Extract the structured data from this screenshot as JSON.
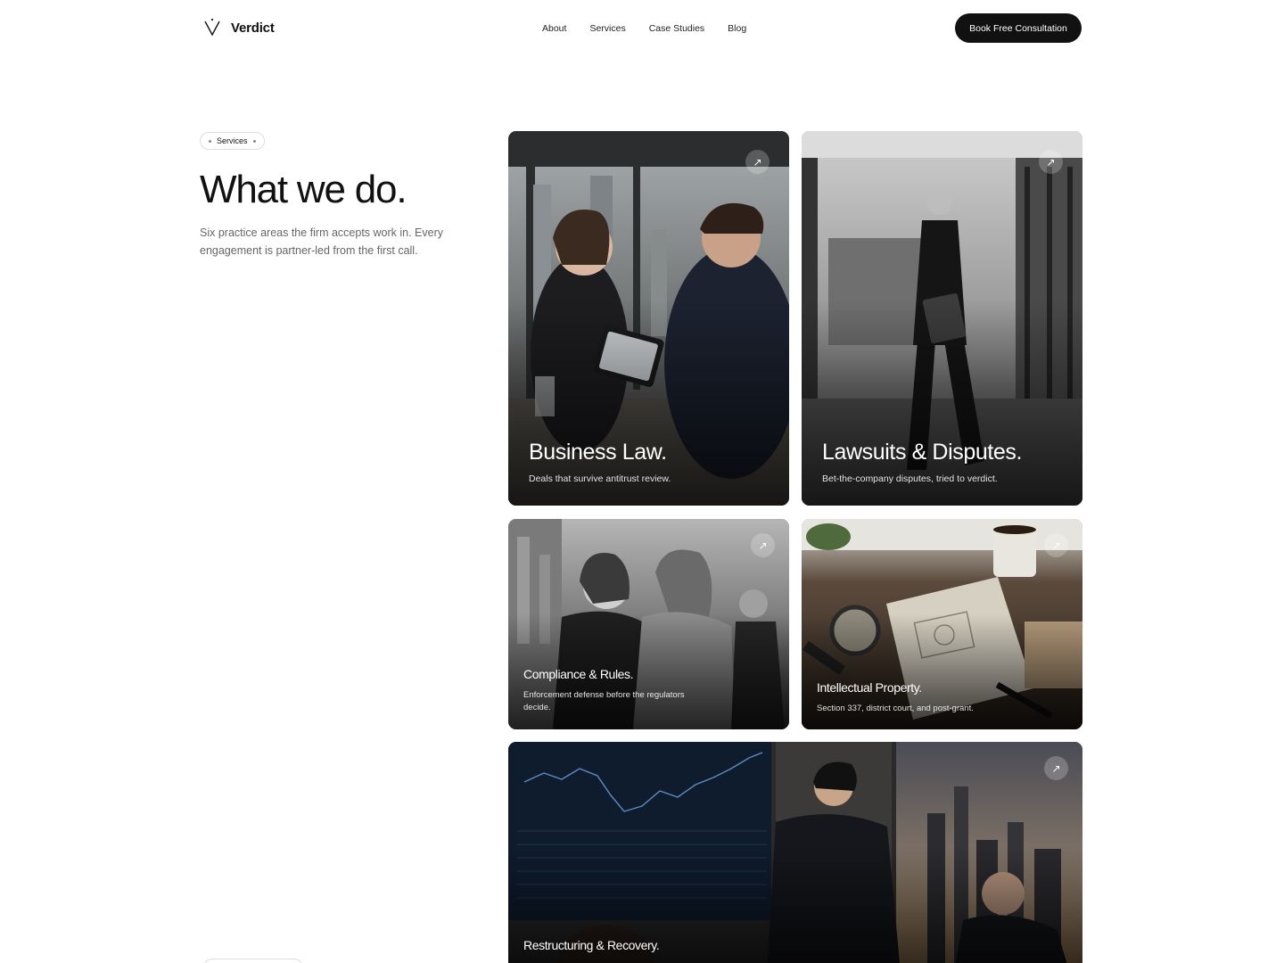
{
  "brand": {
    "name": "Verdict",
    "logo_icon": "v-mark-logo"
  },
  "nav": {
    "items": [
      "About",
      "Services",
      "Case Studies",
      "Blog"
    ],
    "cta_label": "Book Free Consultation"
  },
  "intro": {
    "badge": "Services",
    "title": "What we do.",
    "description": "Six practice areas the firm accepts work in. Every engagement is partner-led from the first call."
  },
  "services": [
    {
      "title": "Business Law.",
      "subtitle": "Deals that survive antitrust review.",
      "icon": "arrow-up-right-icon"
    },
    {
      "title": "Lawsuits & Disputes.",
      "subtitle": "Bet-the-company disputes, tried to verdict.",
      "icon": "arrow-up-right-icon"
    },
    {
      "title": "Compliance & Rules.",
      "subtitle": "Enforcement defense before the regulators decide.",
      "icon": "arrow-up-right-icon"
    },
    {
      "title": "Intellectual Property.",
      "subtitle": "Section 337, district court, and post-grant.",
      "icon": "arrow-up-right-icon"
    },
    {
      "title": "Restructuring & Recovery.",
      "subtitle": "",
      "icon": "arrow-up-right-icon"
    }
  ],
  "arrow_glyph": "↗"
}
